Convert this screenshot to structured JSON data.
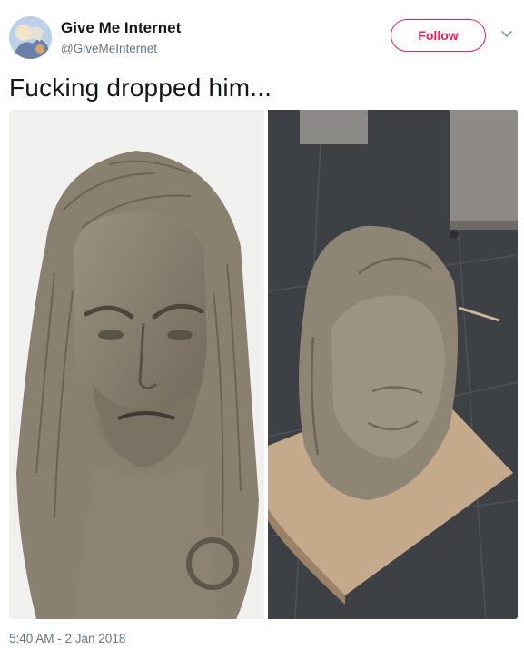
{
  "author": {
    "display_name": "Give Me Internet",
    "handle": "@GiveMeInternet",
    "avatar_icon": "avatar-image"
  },
  "follow_button": {
    "label": "Follow",
    "color": "#e0245e"
  },
  "menu": {
    "icon": "chevron-down-icon"
  },
  "tweet": {
    "text": "Fucking dropped him...",
    "timestamp": "5:40 AM - 2 Jan 2018"
  },
  "media": {
    "photos": [
      {
        "name": "clay-bust-before-photo"
      },
      {
        "name": "clay-bust-dropped-photo"
      }
    ]
  },
  "colors": {
    "text_primary": "#14171a",
    "text_secondary": "#657786",
    "accent": "#e0245e"
  }
}
